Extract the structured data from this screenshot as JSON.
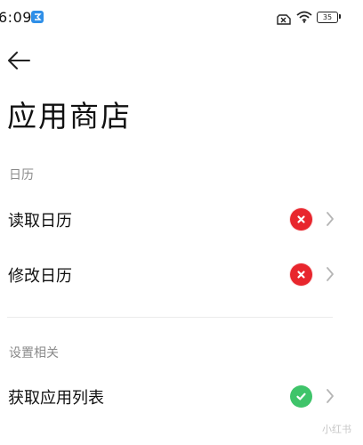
{
  "status_bar": {
    "time": "6:09",
    "battery_level": "35",
    "icons": [
      "app-notification-icon",
      "sim-off-icon",
      "wifi-icon",
      "battery-icon"
    ]
  },
  "header": {
    "back_icon": "arrow-left-icon",
    "title": "应用商店"
  },
  "sections": [
    {
      "header": "日历",
      "items": [
        {
          "label": "读取日历",
          "status": "denied",
          "status_icon": "x-icon"
        },
        {
          "label": "修改日历",
          "status": "denied",
          "status_icon": "x-icon"
        }
      ]
    },
    {
      "header": "设置相关",
      "items": [
        {
          "label": "获取应用列表",
          "status": "allowed",
          "status_icon": "check-icon"
        }
      ]
    }
  ],
  "colors": {
    "denied": "#e8262d",
    "allowed": "#3fc46a",
    "section_header": "#8a8a8a",
    "chevron": "#b5b5b5"
  },
  "watermark": "小红书"
}
